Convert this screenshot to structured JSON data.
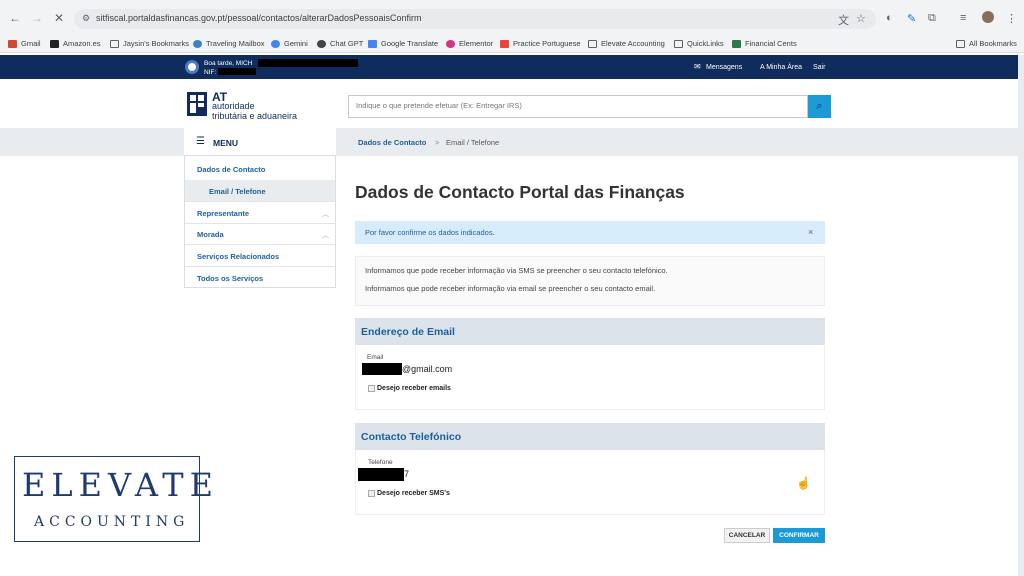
{
  "browser": {
    "url": "sitfiscal.portaldasfinancas.gov.pt/pessoal/contactos/alterarDadosPessoaisConfirm",
    "bookmarks": [
      "Gmail",
      "Amazon.es",
      "Jaysin's Bookmarks",
      "Traveling Mailbox",
      "Gemini",
      "Chat GPT",
      "Google Translate",
      "Elementor",
      "Practice Portuguese",
      "Elevate Accounting",
      "QuickLinks",
      "Financial Cents"
    ],
    "all_bookmarks": "All Bookmarks"
  },
  "topbar": {
    "greeting": "Boa tarde, MICH",
    "nif_label": "NIF:",
    "links": [
      "Mensagens",
      "A Minha Área",
      "Sair"
    ]
  },
  "header": {
    "logo_at": "AT",
    "logo_line1": "autoridade",
    "logo_line2": "tributária e aduaneira",
    "search_placeholder": "Indique o que pretende efetuar (Ex: Entregar IRS)"
  },
  "breadcrumb": {
    "parent": "Dados de Contacto",
    "separator": ">",
    "current": "Email / Telefone"
  },
  "sidebar": {
    "menu_label": "MENU",
    "items": [
      "Dados de Contacto",
      "Email / Telefone",
      "Representante",
      "Morada",
      "Serviços Relacionados",
      "Todos os Serviços"
    ]
  },
  "main": {
    "title": "Dados de Contacto Portal das Finanças",
    "alert": "Por favor confirme os dados indicados.",
    "alert_close": "×",
    "info": [
      "Informamos que pode receber informação via SMS se preencher o seu contacto telefónico.",
      "Informamos que pode receber informação via email se preencher o seu contacto email."
    ],
    "email_section": {
      "title": "Endereço de Email",
      "label": "Email",
      "value_suffix": "@gmail.com",
      "checkbox": "Desejo receber emails"
    },
    "phone_section": {
      "title": "Contacto Telefónico",
      "label": "Telefone",
      "value_suffix": "7",
      "checkbox": "Desejo receber SMS's"
    },
    "buttons": {
      "cancel": "CANCELAR",
      "confirm": "CONFIRMAR"
    }
  },
  "watermark": {
    "line1": "ELEVATE",
    "line2": "ACCOUNTING"
  },
  "colors": {
    "navy": "#0f2c5c",
    "accent": "#1b9ad6",
    "link": "#1d5f9c"
  }
}
